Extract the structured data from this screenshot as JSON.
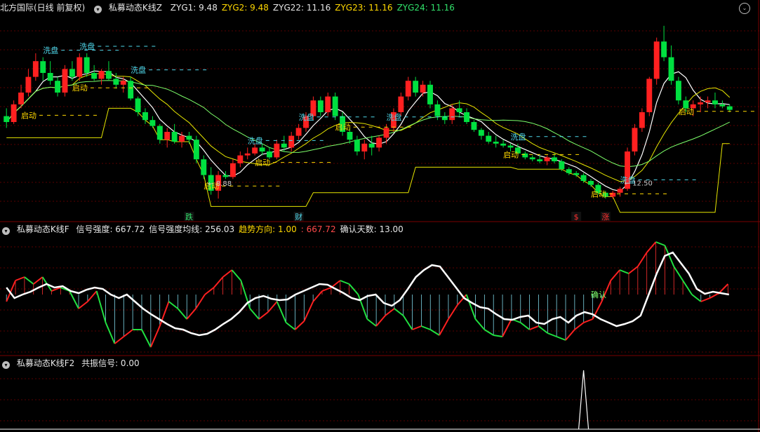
{
  "header1": {
    "instrument": "北方国际(日线 前复权)",
    "indicator": "私募动态K线Z",
    "items": [
      {
        "label": "ZYG1: 9.48",
        "color": "#e6e6e6"
      },
      {
        "label": "ZYG2: 9.48",
        "color": "#ffd800"
      },
      {
        "label": "ZYG22: 11.16",
        "color": "#e6e6e6"
      },
      {
        "label": "ZYG23: 11.16",
        "color": "#ffd800"
      },
      {
        "label": "ZYG24: 11.16",
        "color": "#31e06a"
      }
    ]
  },
  "header2": {
    "indicator": "私募动态K线F",
    "items": [
      {
        "label": "信号强度: 667.72",
        "color": "#e6e6e6"
      },
      {
        "label": "信号强度均线: 256.03",
        "color": "#e6e6e6"
      },
      {
        "label": "趋势方向: 1.00",
        "color": "#ffd800"
      },
      {
        "label": ": 667.72",
        "color": "#ff4a4a"
      },
      {
        "label": "确认天数: 13.00",
        "color": "#e6e6e6"
      }
    ]
  },
  "header3": {
    "indicator": "私募动态K线F2",
    "items": [
      {
        "label": "共振信号: 0.00",
        "color": "#e6e6e6"
      }
    ]
  },
  "icons": {
    "collapse": "chevron-down-icon",
    "expand": "chevron-double-down-icon"
  },
  "colors": {
    "up": "#ff2020",
    "down": "#00e040",
    "text_cyan": "#4fd7ea",
    "text_yellow": "#ffd800",
    "ma_white": "#ffffff",
    "ma_yellow": "#e6e600",
    "ma_green": "#7dff6a",
    "grid": "#5a0000"
  },
  "chart_data": {
    "type": "candlestick",
    "candles": [
      [
        11.0,
        11.2,
        10.7,
        10.85
      ],
      [
        10.85,
        11.4,
        10.8,
        11.3
      ],
      [
        11.3,
        11.8,
        11.2,
        11.6
      ],
      [
        11.6,
        12.2,
        11.5,
        12.0
      ],
      [
        12.0,
        12.6,
        11.9,
        12.4
      ],
      [
        12.4,
        12.5,
        11.9,
        12.1
      ],
      [
        12.1,
        12.4,
        11.8,
        11.9
      ],
      [
        11.9,
        12.0,
        11.5,
        11.6
      ],
      [
        11.6,
        12.3,
        11.5,
        12.2
      ],
      [
        12.2,
        12.4,
        11.9,
        12.0
      ],
      [
        12.0,
        12.6,
        11.9,
        12.5
      ],
      [
        12.5,
        12.6,
        12.0,
        12.1
      ],
      [
        12.1,
        12.3,
        11.9,
        11.95
      ],
      [
        11.95,
        12.2,
        11.8,
        12.15
      ],
      [
        12.15,
        12.4,
        11.9,
        11.95
      ],
      [
        11.95,
        12.1,
        11.7,
        11.8
      ],
      [
        11.8,
        12.0,
        11.6,
        11.9
      ],
      [
        11.9,
        12.0,
        11.4,
        11.45
      ],
      [
        11.45,
        11.5,
        11.0,
        11.1
      ],
      [
        11.1,
        11.2,
        10.8,
        10.9
      ],
      [
        10.9,
        11.0,
        10.7,
        10.75
      ],
      [
        10.75,
        10.8,
        10.3,
        10.4
      ],
      [
        10.4,
        10.7,
        10.2,
        10.6
      ],
      [
        10.6,
        10.8,
        10.3,
        10.35
      ],
      [
        10.35,
        10.6,
        10.2,
        10.5
      ],
      [
        10.5,
        10.6,
        10.3,
        10.4
      ],
      [
        10.4,
        10.5,
        9.8,
        9.9
      ],
      [
        9.9,
        10.0,
        9.4,
        9.5
      ],
      [
        9.5,
        9.7,
        9.0,
        9.1
      ],
      [
        9.1,
        9.6,
        8.9,
        9.5
      ],
      [
        9.5,
        9.6,
        9.4,
        9.45
      ],
      [
        9.45,
        9.9,
        9.4,
        9.8
      ],
      [
        9.8,
        10.1,
        9.7,
        10.0
      ],
      [
        10.0,
        10.2,
        9.9,
        10.05
      ],
      [
        10.05,
        10.3,
        10.0,
        10.2
      ],
      [
        10.2,
        10.3,
        10.0,
        10.1
      ],
      [
        10.1,
        10.2,
        9.9,
        9.95
      ],
      [
        9.95,
        10.4,
        9.9,
        10.3
      ],
      [
        10.3,
        10.5,
        10.1,
        10.2
      ],
      [
        10.2,
        10.6,
        10.1,
        10.5
      ],
      [
        10.5,
        10.8,
        10.4,
        10.7
      ],
      [
        10.7,
        11.1,
        10.6,
        11.0
      ],
      [
        11.0,
        11.5,
        10.9,
        11.4
      ],
      [
        11.4,
        11.5,
        11.0,
        11.1
      ],
      [
        11.1,
        11.6,
        11.0,
        11.5
      ],
      [
        11.5,
        11.6,
        10.9,
        11.0
      ],
      [
        11.0,
        11.1,
        10.5,
        10.6
      ],
      [
        10.6,
        10.7,
        10.3,
        10.4
      ],
      [
        10.4,
        10.5,
        10.0,
        10.1
      ],
      [
        10.1,
        10.4,
        9.9,
        10.3
      ],
      [
        10.3,
        10.5,
        10.0,
        10.2
      ],
      [
        10.2,
        10.5,
        10.1,
        10.45
      ],
      [
        10.45,
        10.8,
        10.3,
        10.7
      ],
      [
        10.7,
        11.2,
        10.6,
        11.1
      ],
      [
        11.1,
        11.6,
        11.0,
        11.5
      ],
      [
        11.5,
        12.0,
        11.4,
        11.9
      ],
      [
        11.9,
        12.0,
        11.5,
        11.6
      ],
      [
        11.6,
        11.9,
        11.5,
        11.8
      ],
      [
        11.8,
        11.9,
        11.2,
        11.3
      ],
      [
        11.3,
        11.4,
        10.9,
        11.0
      ],
      [
        11.0,
        11.1,
        10.8,
        10.9
      ],
      [
        10.9,
        11.3,
        10.8,
        11.2
      ],
      [
        11.2,
        11.4,
        11.0,
        11.1
      ],
      [
        11.1,
        11.2,
        10.8,
        10.85
      ],
      [
        10.85,
        10.9,
        10.6,
        10.65
      ],
      [
        10.65,
        10.7,
        10.4,
        10.5
      ],
      [
        10.5,
        10.6,
        10.3,
        10.35
      ],
      [
        10.35,
        10.5,
        10.2,
        10.3
      ],
      [
        10.3,
        10.4,
        10.2,
        10.25
      ],
      [
        10.25,
        10.3,
        10.1,
        10.2
      ],
      [
        10.2,
        10.3,
        10.0,
        10.05
      ],
      [
        10.05,
        10.1,
        9.9,
        9.95
      ],
      [
        9.95,
        10.0,
        9.85,
        9.9
      ],
      [
        9.9,
        10.0,
        9.8,
        9.85
      ],
      [
        9.85,
        10.0,
        9.75,
        9.95
      ],
      [
        9.95,
        10.05,
        9.8,
        9.85
      ],
      [
        9.85,
        9.9,
        9.6,
        9.65
      ],
      [
        9.65,
        9.7,
        9.5,
        9.55
      ],
      [
        9.55,
        9.6,
        9.45,
        9.5
      ],
      [
        9.5,
        9.55,
        9.3,
        9.35
      ],
      [
        9.35,
        9.4,
        9.2,
        9.25
      ],
      [
        9.25,
        9.3,
        9.0,
        9.05
      ],
      [
        9.05,
        9.1,
        8.9,
        8.95
      ],
      [
        8.95,
        9.1,
        8.9,
        9.05
      ],
      [
        9.05,
        9.2,
        8.95,
        9.15
      ],
      [
        9.15,
        10.2,
        9.1,
        10.1
      ],
      [
        10.1,
        10.8,
        10.0,
        10.7
      ],
      [
        10.7,
        11.2,
        10.6,
        11.1
      ],
      [
        11.1,
        12.0,
        11.0,
        11.95
      ],
      [
        11.95,
        13.0,
        11.8,
        12.9
      ],
      [
        12.9,
        13.3,
        12.4,
        12.5
      ],
      [
        12.5,
        12.8,
        11.8,
        11.9
      ],
      [
        11.9,
        12.0,
        11.3,
        11.4
      ],
      [
        11.4,
        11.5,
        11.1,
        11.2
      ],
      [
        11.2,
        11.4,
        11.0,
        11.3
      ],
      [
        11.3,
        11.5,
        11.1,
        11.35
      ],
      [
        11.35,
        11.5,
        11.2,
        11.4
      ],
      [
        11.4,
        11.6,
        11.2,
        11.3
      ],
      [
        11.3,
        11.4,
        11.2,
        11.25
      ],
      [
        11.25,
        11.3,
        11.1,
        11.16
      ]
    ],
    "price_range": [
      8.6,
      13.6
    ],
    "annotations": [
      {
        "bar": 5,
        "text": "洗盘",
        "color": "cyan"
      },
      {
        "bar": 10,
        "text": "洗盘",
        "color": "cyan"
      },
      {
        "bar": 17,
        "text": "洗盘",
        "color": "cyan"
      },
      {
        "bar": 2,
        "text": "启动",
        "color": "yellow"
      },
      {
        "bar": 9,
        "text": "启动",
        "color": "yellow"
      },
      {
        "bar": 27,
        "text": "启动",
        "color": "yellow"
      },
      {
        "bar": 33,
        "text": "洗盘",
        "color": "cyan"
      },
      {
        "bar": 34,
        "text": "启动",
        "color": "yellow"
      },
      {
        "bar": 40,
        "text": "洗盘",
        "color": "cyan"
      },
      {
        "bar": 45,
        "text": "启动",
        "color": "yellow"
      },
      {
        "bar": 52,
        "text": "洗盘",
        "color": "cyan"
      },
      {
        "bar": 68,
        "text": "启动",
        "color": "yellow"
      },
      {
        "bar": 69,
        "text": "洗盘",
        "color": "cyan"
      },
      {
        "bar": 80,
        "text": "启动",
        "color": "yellow"
      },
      {
        "bar": 84,
        "text": "洗盘",
        "color": "cyan"
      },
      {
        "bar": 92,
        "text": "启动",
        "color": "yellow"
      }
    ],
    "price_labels": [
      {
        "bar": 27,
        "text": "8.88"
      },
      {
        "bar": 84,
        "text": "12.50"
      }
    ],
    "signals": [
      {
        "bar": 25,
        "text": "跌",
        "color": "#31e06a"
      },
      {
        "bar": 40,
        "text": "财",
        "color": "#4fd7ea"
      },
      {
        "bar": 78,
        "text": "$",
        "color": "#ff3030"
      },
      {
        "bar": 82,
        "text": "涨",
        "color": "#ff3030"
      }
    ],
    "osc_white": [
      410,
      425,
      420,
      416,
      410,
      405,
      410,
      408,
      415,
      418,
      413,
      410,
      412,
      420,
      425,
      420,
      430,
      440,
      448,
      455,
      462,
      468,
      470,
      475,
      478,
      476,
      470,
      462,
      455,
      445,
      432,
      425,
      422,
      426,
      428,
      427,
      420,
      415,
      410,
      405,
      406,
      412,
      418,
      425,
      428,
      422,
      420,
      432,
      436,
      428,
      412,
      395,
      385,
      378,
      380,
      395,
      410,
      425,
      432,
      438,
      440,
      448,
      455,
      456,
      452,
      450,
      460,
      462,
      455,
      452,
      460,
      450,
      445,
      448,
      455,
      460,
      465,
      462,
      458,
      450,
      420,
      390,
      365,
      360,
      375,
      390,
      412,
      419,
      416,
      418,
      420
    ],
    "osc_bars": [
      430,
      400,
      395,
      405,
      395,
      415,
      410,
      415,
      440,
      430,
      415,
      460,
      490,
      480,
      470,
      470,
      495,
      465,
      430,
      440,
      455,
      440,
      420,
      410,
      395,
      385,
      400,
      440,
      455,
      445,
      430,
      460,
      470,
      458,
      430,
      415,
      410,
      400,
      405,
      420,
      455,
      465,
      450,
      440,
      450,
      470,
      465,
      470,
      478,
      455,
      435,
      420,
      455,
      470,
      478,
      480,
      455,
      460,
      470,
      465,
      475,
      480,
      485,
      470,
      460,
      455,
      430,
      400,
      385,
      390,
      380,
      360,
      345,
      350,
      380,
      400,
      420,
      430,
      425,
      418,
      405
    ],
    "confirm_text": "确认",
    "resonance_spike": {
      "bar": 79,
      "value": 1
    }
  }
}
